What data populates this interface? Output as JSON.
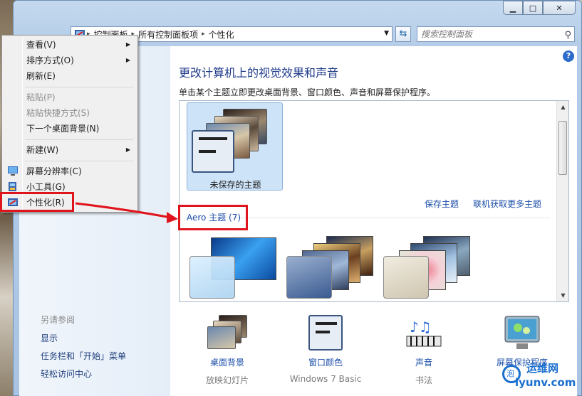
{
  "window": {
    "caption": {
      "minimize": "▁",
      "maximize": "□",
      "close": "✕"
    }
  },
  "address_bar": {
    "crumbs": [
      "控制面板",
      "所有控制面板项",
      "个性化"
    ],
    "icon": "control-panel-icon"
  },
  "search": {
    "placeholder": "搜索控制面板",
    "icon": "search-icon"
  },
  "help": {
    "label": "?"
  },
  "left_pane": {
    "see_also_title": "另请参阅",
    "links": [
      "显示",
      "任务栏和「开始」菜单",
      "轻松访问中心"
    ]
  },
  "main": {
    "title": "更改计算机上的视觉效果和声音",
    "subtitle": "单击某个主题立即更改桌面背景、窗口颜色、声音和屏幕保护程序。",
    "unsaved_theme_label": "未保存的主题",
    "save_theme_link": "保存主题",
    "get_more_link": "联机获取更多主题",
    "aero_heading": "Aero 主题 (7)"
  },
  "bottom_items": [
    {
      "label": "桌面背景",
      "sub": "放映幻灯片",
      "icon": "desktop-background-icon"
    },
    {
      "label": "窗口颜色",
      "sub": "Windows 7 Basic",
      "icon": "window-color-icon"
    },
    {
      "label": "声音",
      "sub": "书法",
      "icon": "sound-icon"
    },
    {
      "label": "屏幕保护程序",
      "sub": "",
      "icon": "screensaver-icon"
    }
  ],
  "context_menu": {
    "items": [
      {
        "label": "查看(V)",
        "submenu": true,
        "enabled": true
      },
      {
        "label": "排序方式(O)",
        "submenu": true,
        "enabled": true
      },
      {
        "label": "刷新(E)",
        "submenu": false,
        "enabled": true
      },
      {
        "label": "粘贴(P)",
        "submenu": false,
        "enabled": false
      },
      {
        "label": "粘贴快捷方式(S)",
        "submenu": false,
        "enabled": false
      },
      {
        "label": "下一个桌面背景(N)",
        "submenu": false,
        "enabled": true
      },
      {
        "label": "新建(W)",
        "submenu": true,
        "enabled": true
      },
      {
        "label": "屏幕分辨率(C)",
        "submenu": false,
        "enabled": true,
        "icon": "screen-resolution-icon"
      },
      {
        "label": "小工具(G)",
        "submenu": false,
        "enabled": true,
        "icon": "gadgets-icon"
      },
      {
        "label": "个性化(R)",
        "submenu": false,
        "enabled": true,
        "icon": "personalize-icon"
      }
    ]
  },
  "watermark": {
    "main": "运维网",
    "sub": "iyunv.com",
    "tagline": "泡"
  },
  "colors": {
    "highlight_red": "#e0141c",
    "link_blue": "#1e4fa8",
    "title_blue": "#1e3a8a"
  }
}
